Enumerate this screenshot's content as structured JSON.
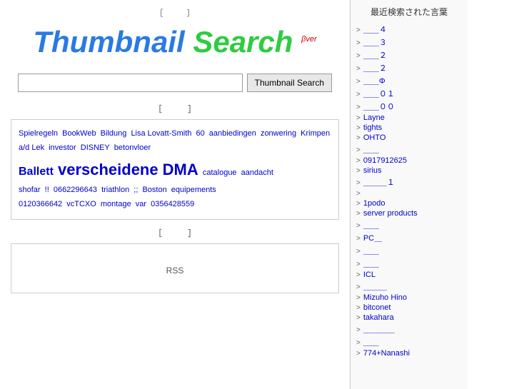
{
  "logo": {
    "part1": "Thumbnail",
    "part2": "Search",
    "beta": "βver"
  },
  "search": {
    "placeholder": "",
    "button_label": "Thumbnail Search"
  },
  "main_bracket_top": "［　　　］",
  "word_cloud_bracket": "［　　　］",
  "words": [
    {
      "text": "Spielregeln",
      "size": "normal"
    },
    {
      "text": "BookWeb",
      "size": "normal"
    },
    {
      "text": "Bildung",
      "size": "normal"
    },
    {
      "text": "Lisa Lovatt-Smith",
      "size": "normal"
    },
    {
      "text": "60",
      "size": "normal"
    },
    {
      "text": "aanbiedingen",
      "size": "normal"
    },
    {
      "text": "zonwering",
      "size": "normal"
    },
    {
      "text": "Krimpen a/d Lek",
      "size": "normal"
    },
    {
      "text": "investor",
      "size": "normal"
    },
    {
      "text": "DISNEY",
      "size": "normal"
    },
    {
      "text": "betonvloer",
      "size": "normal"
    },
    {
      "text": "Ballett",
      "size": "medium"
    },
    {
      "text": "verscheidene",
      "size": "large"
    },
    {
      "text": "DMA",
      "size": "large"
    },
    {
      "text": "catalogue",
      "size": "normal"
    },
    {
      "text": "aandacht",
      "size": "normal"
    },
    {
      "text": "shofar",
      "size": "normal"
    },
    {
      "text": "0662296643",
      "size": "normal"
    },
    {
      "text": "triathlon",
      "size": "normal"
    },
    {
      "text": "Boston",
      "size": "normal"
    },
    {
      "text": "equipements",
      "size": "normal"
    },
    {
      "text": "0120366642",
      "size": "normal"
    },
    {
      "text": "vcTCXO",
      "size": "normal"
    },
    {
      "text": "montage",
      "size": "normal"
    },
    {
      "text": "var",
      "size": "normal"
    },
    {
      "text": "0356428559",
      "size": "normal"
    }
  ],
  "rss_label": "RSS",
  "rss_bracket": "［　　　］",
  "sidebar": {
    "title": "最近検索された言葉",
    "items": [
      {
        "text": "＿＿４"
      },
      {
        "text": "＿＿３"
      },
      {
        "text": "＿＿２"
      },
      {
        "text": "＿＿２"
      },
      {
        "text": "＿＿Φ"
      },
      {
        "text": "＿＿０１"
      },
      {
        "text": "＿＿００"
      },
      {
        "text": "Layne"
      },
      {
        "text": "tights"
      },
      {
        "text": "OHTO"
      },
      {
        "text": "＿＿"
      },
      {
        "text": "0917912625"
      },
      {
        "text": "sirius"
      },
      {
        "text": "＿＿＿１"
      },
      {
        "text": ""
      },
      {
        "text": "1podo"
      },
      {
        "text": "server products"
      },
      {
        "text": "＿＿"
      },
      {
        "text": "PC＿"
      },
      {
        "text": "＿＿"
      },
      {
        "text": "＿＿"
      },
      {
        "text": "ICL"
      },
      {
        "text": "＿＿＿"
      },
      {
        "text": "Mizuho Hino"
      },
      {
        "text": "bitconet"
      },
      {
        "text": "takahara"
      },
      {
        "text": "＿＿＿＿"
      },
      {
        "text": "＿＿"
      },
      {
        "text": "774+Nanashi"
      }
    ]
  }
}
